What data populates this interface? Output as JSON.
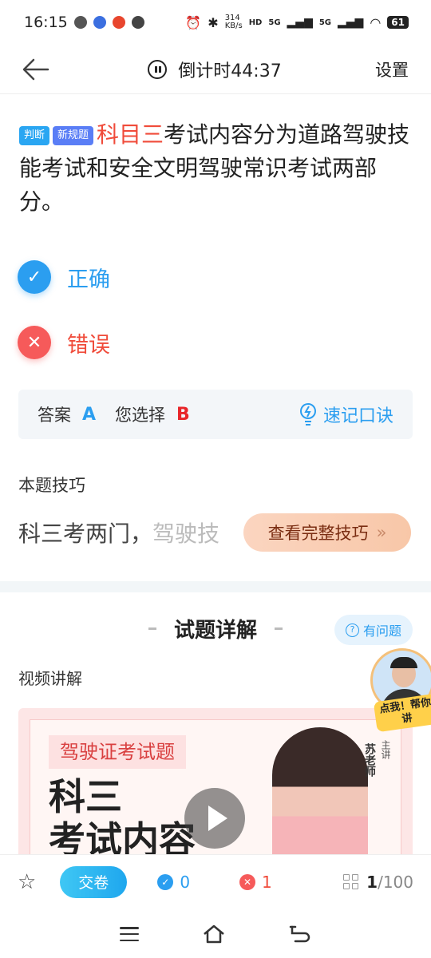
{
  "status": {
    "time": "16:15",
    "battery": "61",
    "speed": "314 KB/s",
    "net1": "5G",
    "net2": "5G"
  },
  "topbar": {
    "timer": "倒计时44:37",
    "settings": "设置"
  },
  "question": {
    "tag1": "判断",
    "tag2": "新规题",
    "highlight": "科目三",
    "text": "考试内容分为道路驾驶技能考试和安全文明驾驶常识考试两部分。"
  },
  "options": [
    {
      "label": "正确"
    },
    {
      "label": "错误"
    }
  ],
  "answer": {
    "label": "答案",
    "correct": "A",
    "selected_label": "您选择",
    "selected": "B",
    "mnemonic": "速记口诀"
  },
  "tips": {
    "title": "本题技巧",
    "text": "科三考两门，",
    "text_faded": "驾驶技",
    "button": "查看完整技巧"
  },
  "detail": {
    "title": "试题详解",
    "ask": "有问题",
    "video_title": "视频讲解"
  },
  "video": {
    "tag": "驾驶证考试题",
    "big1": "科三",
    "big2": "考试内容",
    "name": "苏老师",
    "role": "主讲"
  },
  "help": {
    "text": "点我！帮你讲"
  },
  "bottom": {
    "submit": "交卷",
    "correct_count": "0",
    "wrong_count": "1",
    "current": "1",
    "total": "/100"
  }
}
